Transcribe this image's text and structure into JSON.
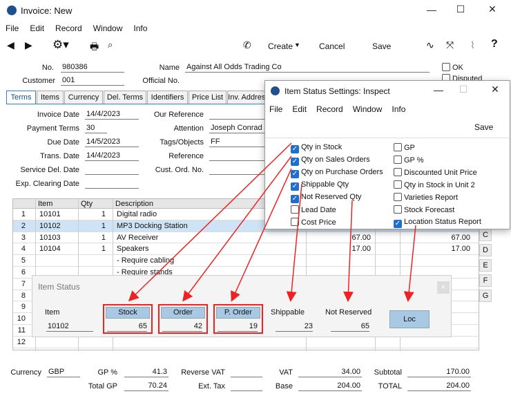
{
  "window": {
    "title": "Invoice: New",
    "menu": [
      "File",
      "Edit",
      "Record",
      "Window",
      "Info"
    ]
  },
  "toolbar": {
    "create": "Create",
    "cancel": "Cancel",
    "save": "Save"
  },
  "header": {
    "no_label": "No.",
    "no": "980386",
    "name_label": "Name",
    "name": "Against All Odds Trading Co",
    "customer_label": "Customer",
    "customer": "001",
    "official_label": "Official No.",
    "ok": "OK",
    "disputed": "Disputed"
  },
  "tabs": [
    "Terms",
    "Items",
    "Currency",
    "Del. Terms",
    "Identifiers",
    "Price List",
    "Inv. Address"
  ],
  "terms": {
    "invoice_date_label": "Invoice Date",
    "invoice_date": "14/4/2023",
    "payment_terms_label": "Payment Terms",
    "payment_terms": "30",
    "due_date_label": "Due Date",
    "due_date": "14/5/2023",
    "trans_date_label": "Trans. Date",
    "trans_date": "14/4/2023",
    "service_label": "Service Del. Date",
    "expclear_label": "Exp. Clearing Date",
    "our_ref_label": "Our Reference",
    "attention_label": "Attention",
    "attention": "Joseph Conrad",
    "tags_label": "Tags/Objects",
    "tags": "FF",
    "reference_label": "Reference",
    "custord_label": "Cust. Ord. No."
  },
  "grid": {
    "cols": [
      "Item",
      "Qty",
      "Description"
    ],
    "rows": [
      {
        "n": "1",
        "item": "10101",
        "qty": "1",
        "desc": "Digital radio",
        "p1": "",
        "p2": ""
      },
      {
        "n": "2",
        "item": "10102",
        "qty": "1",
        "desc": "MP3 Docking Station",
        "p1": "",
        "p2": ""
      },
      {
        "n": "3",
        "item": "10103",
        "qty": "1",
        "desc": "AV Receiver",
        "p1": "67.00",
        "p2": "67.00"
      },
      {
        "n": "4",
        "item": "10104",
        "qty": "1",
        "desc": "Speakers",
        "p1": "17.00",
        "p2": "17.00"
      },
      {
        "n": "5",
        "item": "",
        "qty": "",
        "desc": "- Require cabling",
        "p1": "",
        "p2": ""
      },
      {
        "n": "6",
        "item": "",
        "qty": "",
        "desc": "- Require stands",
        "p1": "",
        "p2": ""
      },
      {
        "n": "7",
        "item": "",
        "qty": "",
        "desc": "",
        "p1": "",
        "p2": ""
      },
      {
        "n": "8",
        "item": "",
        "qty": "",
        "desc": "",
        "p1": "",
        "p2": ""
      },
      {
        "n": "9",
        "item": "",
        "qty": "",
        "desc": "",
        "p1": "",
        "p2": ""
      },
      {
        "n": "10",
        "item": "",
        "qty": "",
        "desc": "",
        "p1": "",
        "p2": ""
      },
      {
        "n": "11",
        "item": "",
        "qty": "",
        "desc": "",
        "p1": "",
        "p2": ""
      },
      {
        "n": "12",
        "item": "",
        "qty": "",
        "desc": "",
        "p1": "",
        "p2": ""
      }
    ],
    "side": [
      "C",
      "D",
      "E",
      "F",
      "G"
    ]
  },
  "dialog": {
    "title": "Item Status Settings: Inspect",
    "menu": [
      "File",
      "Edit",
      "Record",
      "Window",
      "Info"
    ],
    "save": "Save",
    "left": [
      {
        "label": "Qty in Stock",
        "on": true
      },
      {
        "label": "Qty on Sales Orders",
        "on": true
      },
      {
        "label": "Qty on Purchase Orders",
        "on": true
      },
      {
        "label": "Shippable Qty",
        "on": true
      },
      {
        "label": "Not Reserved Qty",
        "on": true
      },
      {
        "label": "Lead Date",
        "on": false
      },
      {
        "label": "Cost Price",
        "on": false
      }
    ],
    "right": [
      {
        "label": "GP",
        "on": false
      },
      {
        "label": "GP %",
        "on": false
      },
      {
        "label": "Discounted Unit Price",
        "on": false
      },
      {
        "label": "Qty in Stock in Unit 2",
        "on": false
      },
      {
        "label": "Varieties Report",
        "on": false
      },
      {
        "label": "Stock Forecast",
        "on": false
      },
      {
        "label": "Location Status Report",
        "on": true
      }
    ]
  },
  "item_status": {
    "title": "Item Status",
    "item_label": "Item",
    "item": "10102",
    "stock_label": "Stock",
    "stock": "65",
    "order_label": "Order",
    "order": "42",
    "porder_label": "P. Order",
    "porder": "19",
    "ship_label": "Shippable",
    "ship": "23",
    "notres_label": "Not Reserved",
    "notres": "65",
    "loc": "Loc",
    "close": "×"
  },
  "footer": {
    "currency_label": "Currency",
    "currency": "GBP",
    "gp_pct_label": "GP %",
    "gp_pct": "41.3",
    "rev_vat_label": "Reverse VAT",
    "vat_label": "VAT",
    "vat": "34.00",
    "subtotal_label": "Subtotal",
    "subtotal": "170.00",
    "total_gp_label": "Total GP",
    "total_gp": "70.24",
    "ext_tax_label": "Ext. Tax",
    "base_label": "Base",
    "base": "204.00",
    "total_label": "TOTAL",
    "total": "204.00"
  },
  "colors": {
    "accent": "#1f6fd1",
    "highlight": "#e22222",
    "header_blue": "#a9c8e4"
  }
}
